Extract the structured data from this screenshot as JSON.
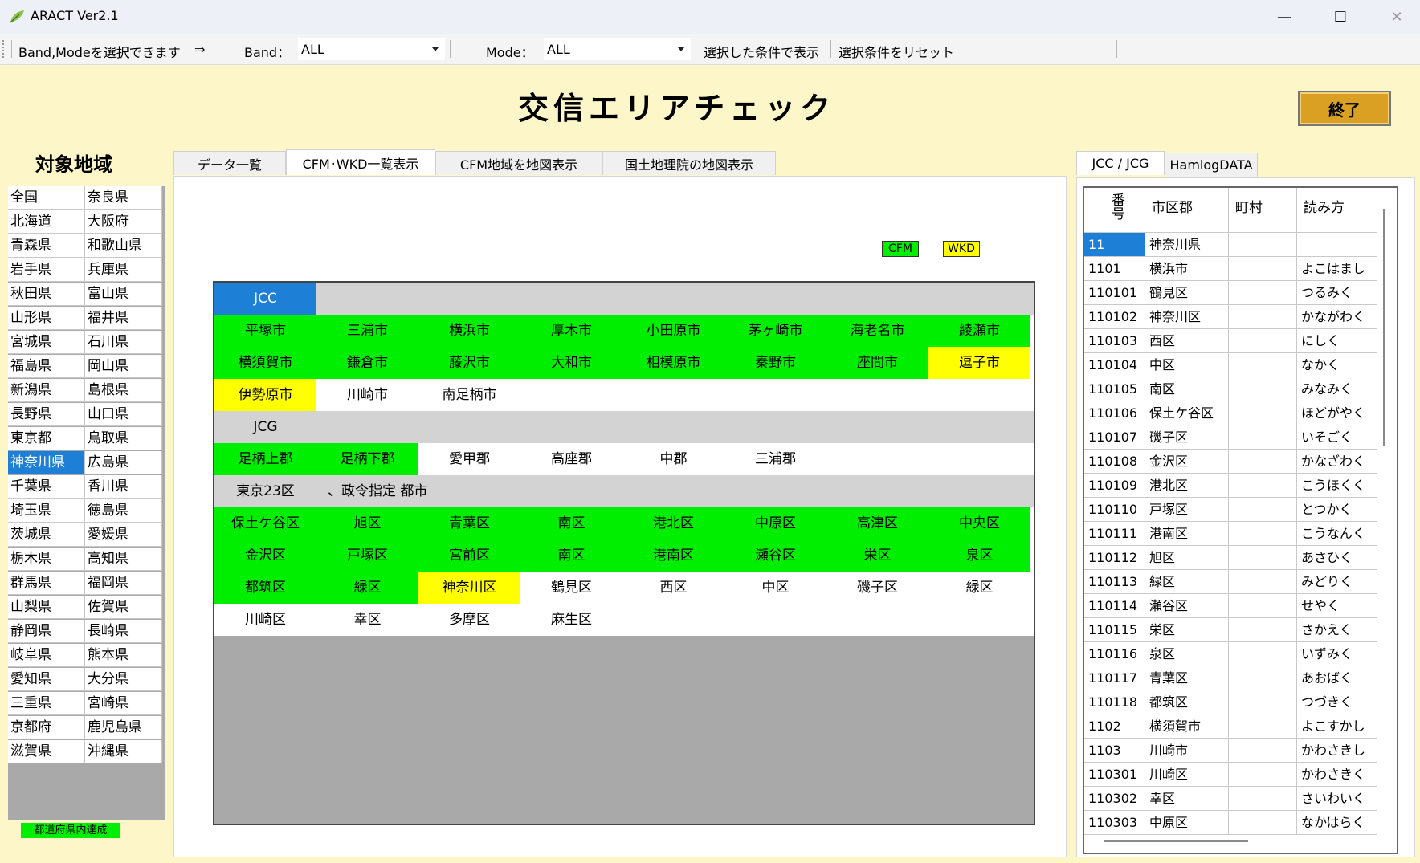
{
  "window": {
    "title": "ARACT Ver2.1",
    "minimize": "—",
    "maximize": "☐",
    "close": "✕"
  },
  "toolbar": {
    "hint": "Band,Modeを選択できます",
    "arrow": "⇒",
    "band_label": "Band：",
    "band_value": "ALL",
    "mode_label": "Mode：",
    "mode_value": "ALL",
    "show_button": "選択した条件で表示",
    "reset_button": "選択条件をリセット"
  },
  "header": {
    "title": "交信エリアチェック",
    "exit_button": "終了"
  },
  "regions": {
    "heading": "対象地域",
    "col1": [
      "全国",
      "北海道",
      "青森県",
      "岩手県",
      "秋田県",
      "山形県",
      "宮城県",
      "福島県",
      "新潟県",
      "長野県",
      "東京都",
      "神奈川県",
      "千葉県",
      "埼玉県",
      "茨城県",
      "栃木県",
      "群馬県",
      "山梨県",
      "静岡県",
      "岐阜県",
      "愛知県",
      "三重県",
      "京都府",
      "滋賀県"
    ],
    "col2": [
      "奈良県",
      "大阪府",
      "和歌山県",
      "兵庫県",
      "富山県",
      "福井県",
      "石川県",
      "岡山県",
      "島根県",
      "山口県",
      "鳥取県",
      "広島県",
      "香川県",
      "徳島県",
      "愛媛県",
      "高知県",
      "福岡県",
      "佐賀県",
      "長崎県",
      "熊本県",
      "大分県",
      "宮崎県",
      "鹿児島県",
      "沖縄県"
    ],
    "selected": "神奈川県",
    "achievement_badge": "都道府県内達成"
  },
  "tabs": [
    "データ一覧",
    "CFM･WKD一覧表示",
    "CFM地域を地図表示",
    "国土地理院の地図表示"
  ],
  "active_tab": 1,
  "legend": {
    "cfm": "CFM",
    "wkd": "WKD",
    "cfm_color": "#00ee00",
    "wkd_color": "#ffff00"
  },
  "colors": {
    "cfm": "#00ee00",
    "wkd": "#ffff00",
    "none": "#ffffff",
    "section": "#d3d3d3",
    "jcc_header": "#1e7fd6"
  },
  "area_grid": [
    {
      "type": "section",
      "cells": [
        {
          "t": "JCC",
          "s": "jcc"
        }
      ]
    },
    {
      "type": "data",
      "cells": [
        {
          "t": "平塚市",
          "s": "cfm"
        },
        {
          "t": "三浦市",
          "s": "cfm"
        },
        {
          "t": "横浜市",
          "s": "cfm"
        },
        {
          "t": "厚木市",
          "s": "cfm"
        },
        {
          "t": "小田原市",
          "s": "cfm"
        },
        {
          "t": "茅ヶ崎市",
          "s": "cfm"
        },
        {
          "t": "海老名市",
          "s": "cfm"
        },
        {
          "t": "綾瀬市",
          "s": "cfm"
        }
      ]
    },
    {
      "type": "data",
      "cells": [
        {
          "t": "横須賀市",
          "s": "cfm"
        },
        {
          "t": "鎌倉市",
          "s": "cfm"
        },
        {
          "t": "藤沢市",
          "s": "cfm"
        },
        {
          "t": "大和市",
          "s": "cfm"
        },
        {
          "t": "相模原市",
          "s": "cfm"
        },
        {
          "t": "秦野市",
          "s": "cfm"
        },
        {
          "t": "座間市",
          "s": "cfm"
        },
        {
          "t": "逗子市",
          "s": "wkd"
        }
      ]
    },
    {
      "type": "data",
      "cells": [
        {
          "t": "伊勢原市",
          "s": "wkd"
        },
        {
          "t": "川崎市",
          "s": "none"
        },
        {
          "t": "南足柄市",
          "s": "none"
        },
        {
          "t": "",
          "s": "none"
        },
        {
          "t": "",
          "s": "none"
        },
        {
          "t": "",
          "s": "none"
        },
        {
          "t": "",
          "s": "none"
        },
        {
          "t": "",
          "s": "none"
        }
      ]
    },
    {
      "type": "section",
      "cells": [
        {
          "t": "JCG",
          "s": "section"
        }
      ]
    },
    {
      "type": "data",
      "cells": [
        {
          "t": "足柄上郡",
          "s": "cfm"
        },
        {
          "t": "足柄下郡",
          "s": "cfm"
        },
        {
          "t": "愛甲郡",
          "s": "none"
        },
        {
          "t": "高座郡",
          "s": "none"
        },
        {
          "t": "中郡",
          "s": "none"
        },
        {
          "t": "三浦郡",
          "s": "none"
        },
        {
          "t": "",
          "s": "none"
        },
        {
          "t": "",
          "s": "none"
        }
      ]
    },
    {
      "type": "section",
      "cells": [
        {
          "t": "東京23区",
          "s": "section"
        },
        {
          "t": "、政令指定 都市",
          "s": "section"
        }
      ]
    },
    {
      "type": "data",
      "cells": [
        {
          "t": "保土ケ谷区",
          "s": "cfm"
        },
        {
          "t": "旭区",
          "s": "cfm"
        },
        {
          "t": "青葉区",
          "s": "cfm"
        },
        {
          "t": "南区",
          "s": "cfm"
        },
        {
          "t": "港北区",
          "s": "cfm"
        },
        {
          "t": "中原区",
          "s": "cfm"
        },
        {
          "t": "高津区",
          "s": "cfm"
        },
        {
          "t": "中央区",
          "s": "cfm"
        }
      ]
    },
    {
      "type": "data",
      "cells": [
        {
          "t": "金沢区",
          "s": "cfm"
        },
        {
          "t": "戸塚区",
          "s": "cfm"
        },
        {
          "t": "宮前区",
          "s": "cfm"
        },
        {
          "t": "南区",
          "s": "cfm"
        },
        {
          "t": "港南区",
          "s": "cfm"
        },
        {
          "t": "瀬谷区",
          "s": "cfm"
        },
        {
          "t": "栄区",
          "s": "cfm"
        },
        {
          "t": "泉区",
          "s": "cfm"
        }
      ]
    },
    {
      "type": "data",
      "cells": [
        {
          "t": "都筑区",
          "s": "cfm"
        },
        {
          "t": "緑区",
          "s": "cfm"
        },
        {
          "t": "神奈川区",
          "s": "wkd"
        },
        {
          "t": "鶴見区",
          "s": "none"
        },
        {
          "t": "西区",
          "s": "none"
        },
        {
          "t": "中区",
          "s": "none"
        },
        {
          "t": "磯子区",
          "s": "none"
        },
        {
          "t": "緑区",
          "s": "none"
        }
      ]
    },
    {
      "type": "data",
      "cells": [
        {
          "t": "川崎区",
          "s": "none"
        },
        {
          "t": "幸区",
          "s": "none"
        },
        {
          "t": "多摩区",
          "s": "none"
        },
        {
          "t": "麻生区",
          "s": "none"
        },
        {
          "t": "",
          "s": "none"
        },
        {
          "t": "",
          "s": "none"
        },
        {
          "t": "",
          "s": "none"
        },
        {
          "t": "",
          "s": "none"
        }
      ]
    }
  ],
  "right_tabs": [
    "JCC / JCG",
    "HamlogDATA"
  ],
  "jcc_table": {
    "headers": [
      "番号",
      "市区郡",
      "町村",
      "読み方"
    ],
    "rows": [
      [
        "11",
        "神奈川県",
        "",
        ""
      ],
      [
        "1101",
        "横浜市",
        "",
        "よこはまし"
      ],
      [
        "110101",
        "鶴見区",
        "",
        "つるみく"
      ],
      [
        "110102",
        "神奈川区",
        "",
        "かながわく"
      ],
      [
        "110103",
        "西区",
        "",
        "にしく"
      ],
      [
        "110104",
        "中区",
        "",
        "なかく"
      ],
      [
        "110105",
        "南区",
        "",
        "みなみく"
      ],
      [
        "110106",
        "保土ケ谷区",
        "",
        "ほどがやく"
      ],
      [
        "110107",
        "磯子区",
        "",
        "いそごく"
      ],
      [
        "110108",
        "金沢区",
        "",
        "かなざわく"
      ],
      [
        "110109",
        "港北区",
        "",
        "こうほくく"
      ],
      [
        "110110",
        "戸塚区",
        "",
        "とつかく"
      ],
      [
        "110111",
        "港南区",
        "",
        "こうなんく"
      ],
      [
        "110112",
        "旭区",
        "",
        "あさひく"
      ],
      [
        "110113",
        "緑区",
        "",
        "みどりく"
      ],
      [
        "110114",
        "瀬谷区",
        "",
        "せやく"
      ],
      [
        "110115",
        "栄区",
        "",
        "さかえく"
      ],
      [
        "110116",
        "泉区",
        "",
        "いずみく"
      ],
      [
        "110117",
        "青葉区",
        "",
        "あおばく"
      ],
      [
        "110118",
        "都筑区",
        "",
        "つづきく"
      ],
      [
        "1102",
        "横須賀市",
        "",
        "よこすかし"
      ],
      [
        "1103",
        "川崎市",
        "",
        "かわさきし"
      ],
      [
        "110301",
        "川崎区",
        "",
        "かわさきく"
      ],
      [
        "110302",
        "幸区",
        "",
        "さいわいく"
      ],
      [
        "110303",
        "中原区",
        "",
        "なかはらく"
      ]
    ]
  }
}
